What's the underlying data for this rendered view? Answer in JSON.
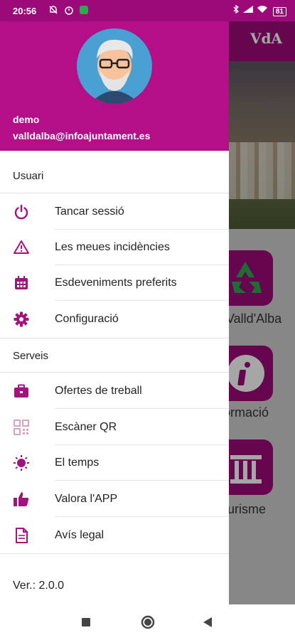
{
  "status_bar": {
    "time": "20:56",
    "battery": "81"
  },
  "background": {
    "tiles": [
      {
        "label": "Valld'Alba"
      },
      {
        "label": "ormació"
      },
      {
        "label": "urisme"
      }
    ],
    "logo": "VdA"
  },
  "drawer": {
    "user": {
      "name": "demo",
      "email": "valldalba@infoajuntament.es"
    },
    "sections": {
      "user_title": "Usuari",
      "services_title": "Serveis"
    },
    "user_items": [
      {
        "label": "Tancar sessió",
        "icon": "power-icon"
      },
      {
        "label": "Les meues incidències",
        "icon": "warning-icon"
      },
      {
        "label": "Esdeveniments preferits",
        "icon": "calendar-icon"
      },
      {
        "label": "Configuració",
        "icon": "gear-icon"
      }
    ],
    "service_items": [
      {
        "label": "Ofertes de treball",
        "icon": "briefcase-icon"
      },
      {
        "label": "Escàner QR",
        "icon": "qr-code-icon"
      },
      {
        "label": "El temps",
        "icon": "sun-icon"
      },
      {
        "label": "Valora l'APP",
        "icon": "thumbs-up-icon"
      },
      {
        "label": "Avís legal",
        "icon": "document-icon"
      }
    ],
    "version": "Ver.: 2.0.0"
  },
  "colors": {
    "accent": "#b40f87",
    "topbar": "#9c0a7a",
    "icon": "#a3137d"
  }
}
